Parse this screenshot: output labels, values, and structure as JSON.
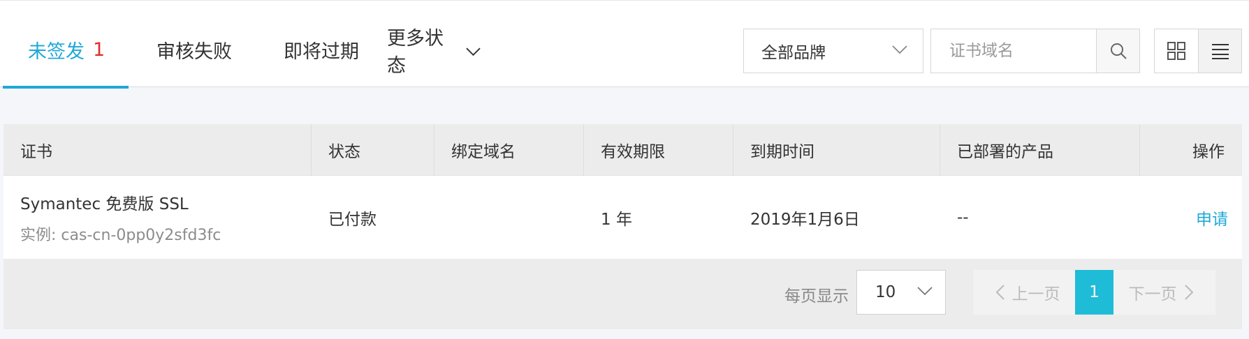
{
  "tabs": [
    {
      "label": "未签发",
      "count": "1",
      "active": true
    },
    {
      "label": "审核失败"
    },
    {
      "label": "即将过期"
    },
    {
      "label": "更多状态"
    }
  ],
  "filters": {
    "brand_select_value": "全部品牌",
    "search_placeholder": "证书域名",
    "search_value": ""
  },
  "view_modes": [
    "grid-view-icon",
    "list-view-icon"
  ],
  "table": {
    "columns": [
      "证书",
      "状态",
      "绑定域名",
      "有效期限",
      "到期时间",
      "已部署的产品",
      "操作"
    ],
    "rows": [
      {
        "cert_name": "Symantec 免费版 SSL",
        "cert_instance": "实例: cas-cn-0pp0y2sfd3fc",
        "status": "已付款",
        "domain": "",
        "validity": "1 年",
        "expire": "2019年1月6日",
        "deployed": "--",
        "action": "申请"
      }
    ]
  },
  "pagination": {
    "per_page_label": "每页显示",
    "per_page_value": "10",
    "prev_label": "上一页",
    "current_page": "1",
    "next_label": "下一页"
  },
  "colors": {
    "accent": "#1fa8d7",
    "count_red": "#e22b2b",
    "current_page": "#1fbcd7"
  }
}
